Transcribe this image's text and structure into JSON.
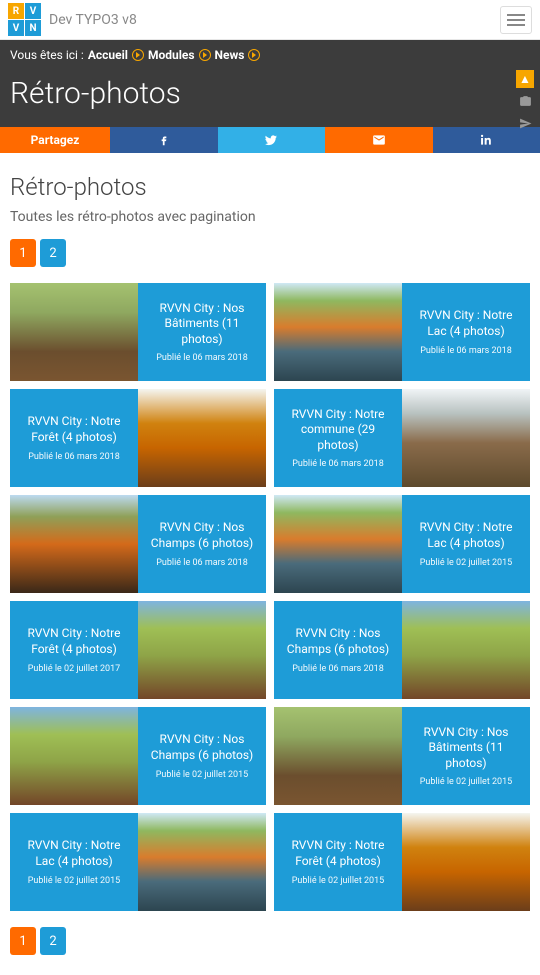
{
  "nav": {
    "brand": "Dev TYPO3 v8"
  },
  "breadcrumb": {
    "prefix": "Vous êtes ici :",
    "items": [
      "Accueil",
      "Modules",
      "News"
    ]
  },
  "header": {
    "title": "Rétro-photos"
  },
  "share": {
    "label": "Partagez",
    "facebook": "Facebook",
    "twitter": "Twitter",
    "email": "Email",
    "linkedin": "LinkedIn"
  },
  "content": {
    "title": "Rétro-photos",
    "subtitle": "Toutes les rétro-photos avec pagination"
  },
  "pagination": {
    "current": "1",
    "pages": [
      "1",
      "2"
    ]
  },
  "cards": [
    {
      "title": "RVVN City : Nos Bâtiments (11 photos)",
      "date": "Publié le 06 mars 2018",
      "thumb": "thumb-g1",
      "reverse": false
    },
    {
      "title": "RVVN City : Notre Lac (4 photos)",
      "date": "Publié le 06 mars 2018",
      "thumb": "thumb-g2",
      "reverse": false
    },
    {
      "title": "RVVN City : Notre Forêt (4 photos)",
      "date": "Publié le 06 mars 2018",
      "thumb": "thumb-g3",
      "reverse": true
    },
    {
      "title": "RVVN City : Notre commune (29 photos)",
      "date": "Publié le 06 mars 2018",
      "thumb": "thumb-g4",
      "reverse": true
    },
    {
      "title": "RVVN City : Nos Champs (6 photos)",
      "date": "Publié le 06 mars 2018",
      "thumb": "thumb-g5",
      "reverse": false
    },
    {
      "title": "RVVN City : Notre Lac (4 photos)",
      "date": "Publié le 02 juillet 2015",
      "thumb": "thumb-g2",
      "reverse": false
    },
    {
      "title": "RVVN City : Notre Forêt (4 photos)",
      "date": "Publié le 02 juillet 2017",
      "thumb": "thumb-g6",
      "reverse": true
    },
    {
      "title": "RVVN City : Nos Champs (6 photos)",
      "date": "Publié le 06 mars 2018",
      "thumb": "thumb-g6",
      "reverse": true
    },
    {
      "title": "RVVN City : Nos Champs (6 photos)",
      "date": "Publié le 02 juillet 2015",
      "thumb": "thumb-g6",
      "reverse": false
    },
    {
      "title": "RVVN City : Nos Bâtiments (11 photos)",
      "date": "Publié le 02 juillet 2015",
      "thumb": "thumb-g1",
      "reverse": false
    },
    {
      "title": "RVVN City : Notre Lac (4 photos)",
      "date": "Publié le 02 juillet 2015",
      "thumb": "thumb-g2",
      "reverse": true
    },
    {
      "title": "RVVN City : Notre Forêt (4 photos)",
      "date": "Publié le 02 juillet 2015",
      "thumb": "thumb-g3",
      "reverse": true
    }
  ]
}
